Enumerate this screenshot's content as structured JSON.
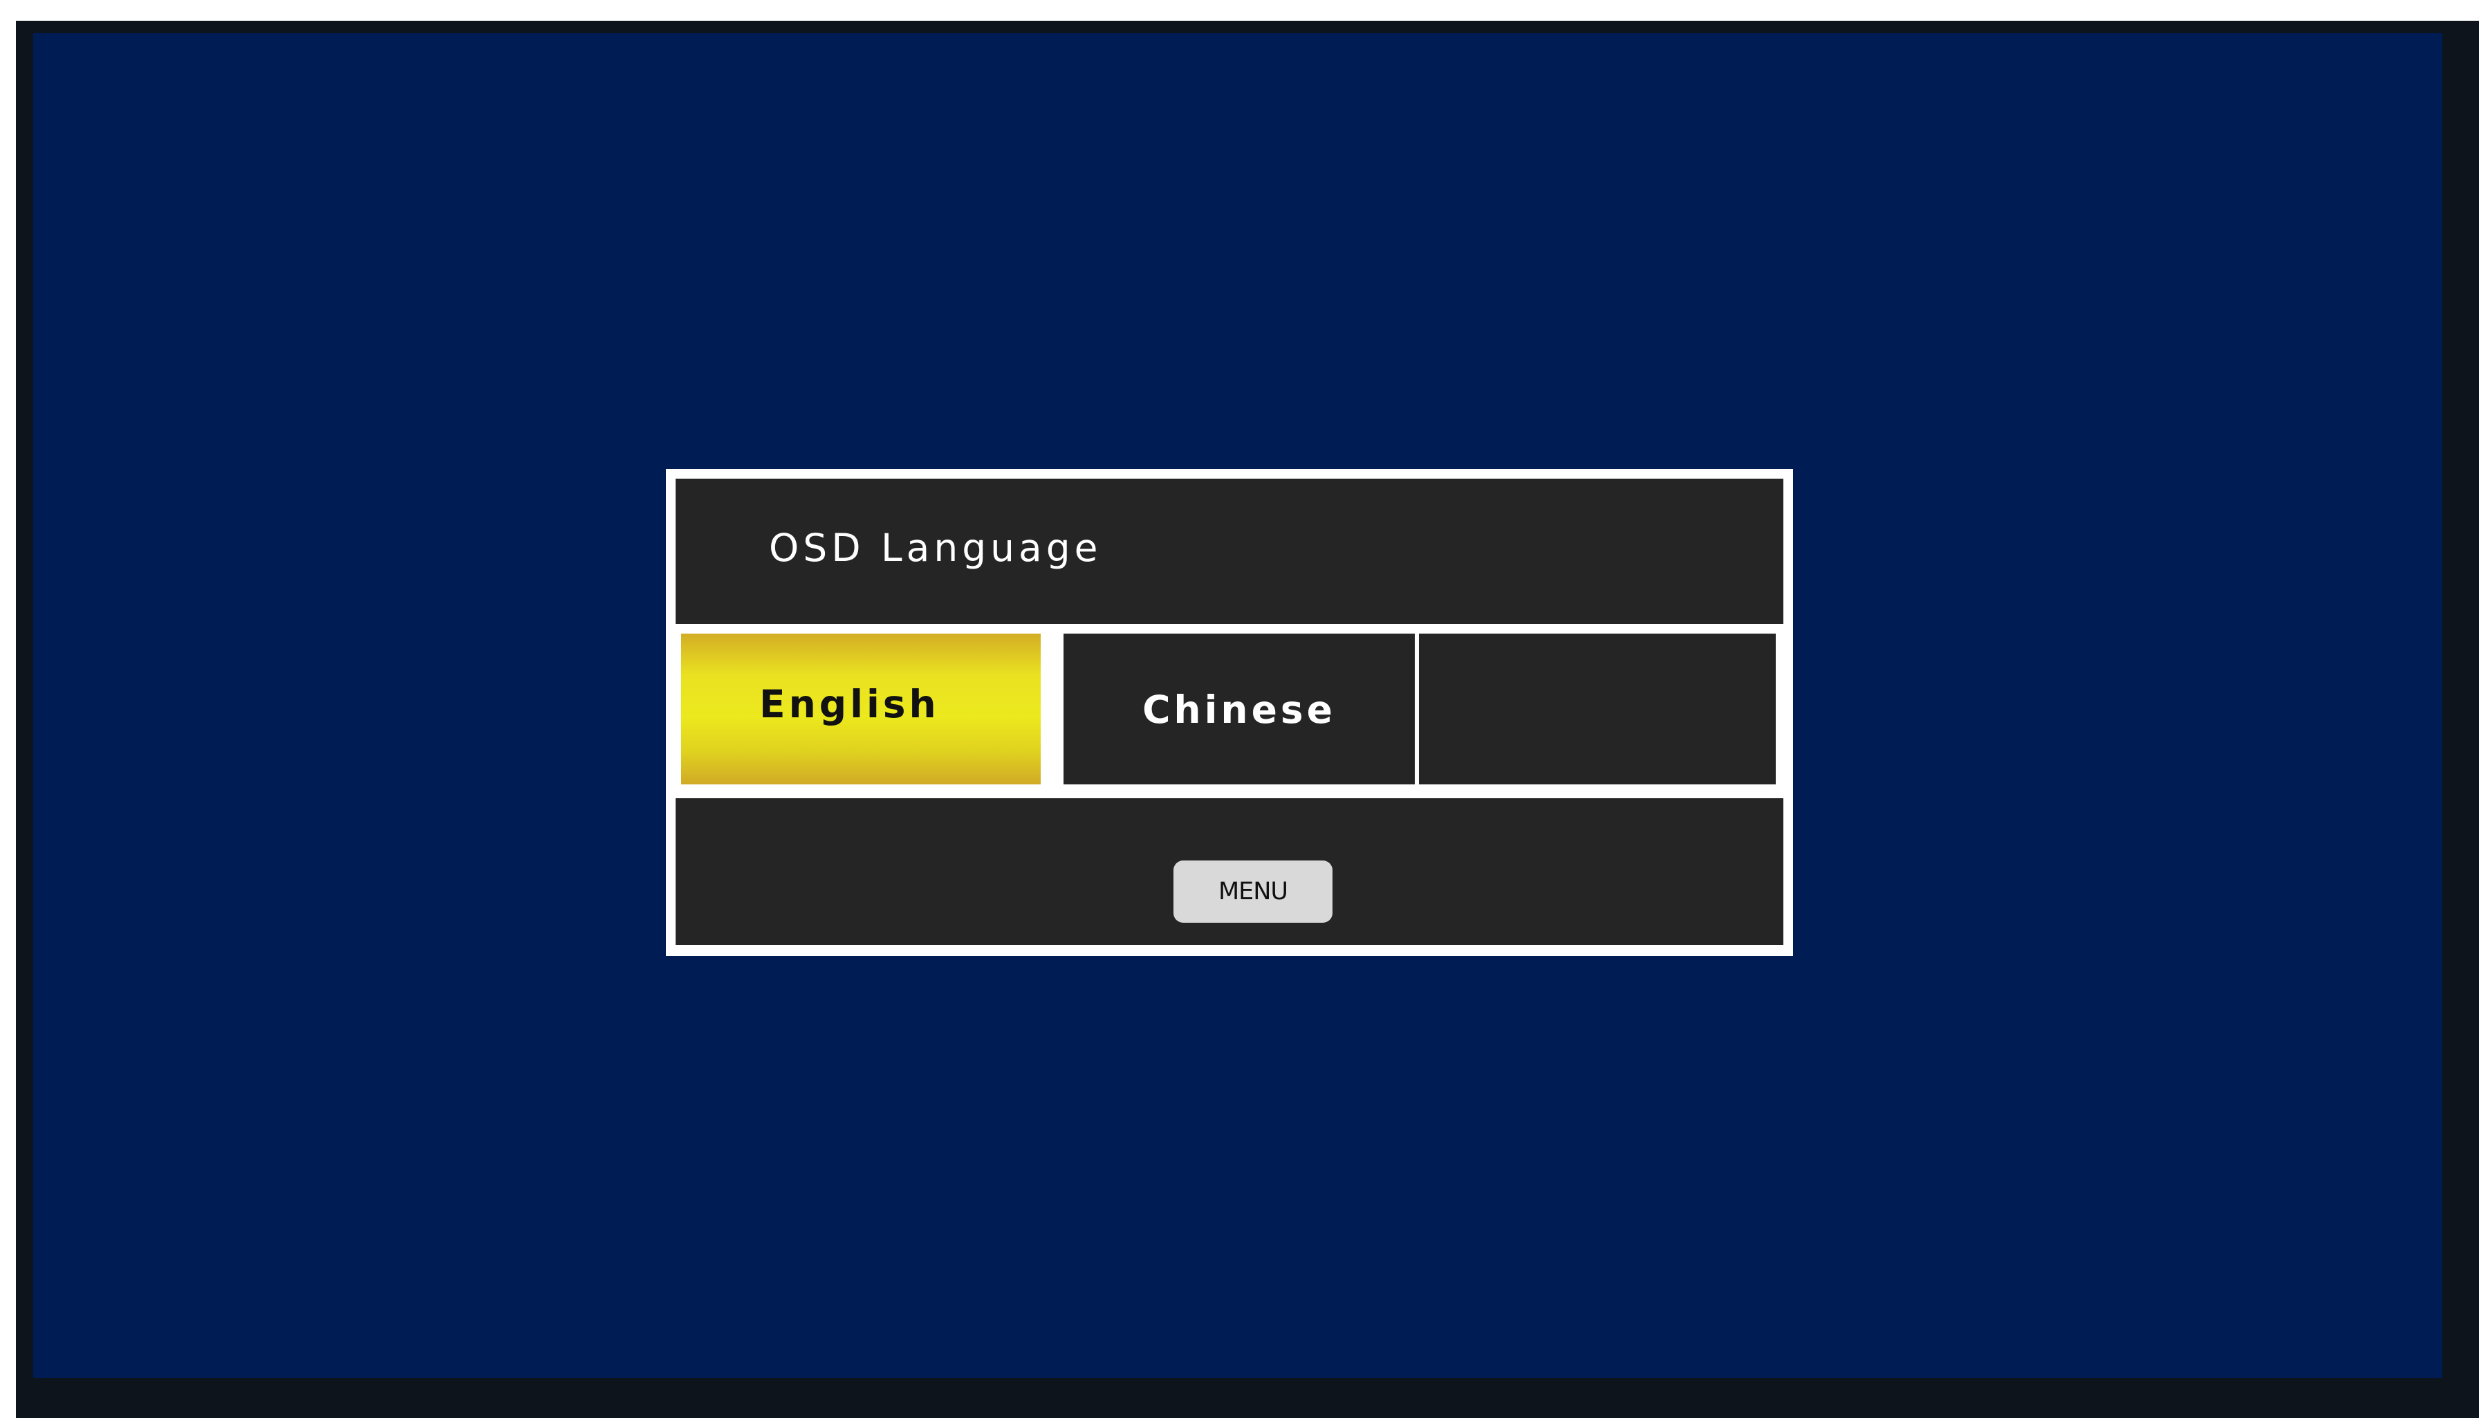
{
  "osd": {
    "title": "OSD Language",
    "options": [
      {
        "label": "English",
        "selected": true
      },
      {
        "label": "Chinese",
        "selected": false
      },
      {
        "label": "",
        "selected": false
      }
    ],
    "menu_label": "MENU"
  },
  "colors": {
    "screen_background": "#001c54",
    "bezel": "#0d141c",
    "panel": "#252525",
    "panel_border": "#ffffff",
    "selected_highlight": "#ece91e",
    "menu_button": "#d9d9d9"
  }
}
